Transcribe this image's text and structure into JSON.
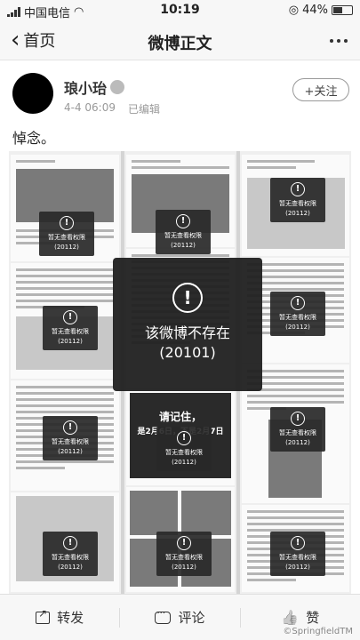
{
  "status_bar": {
    "carrier": "中国电信",
    "time": "10:19",
    "battery": "44%"
  },
  "nav": {
    "back_label": "首页",
    "title": "微博正文"
  },
  "post": {
    "author": "琅小珆",
    "date": "4-4 06:09",
    "edited": "已编辑",
    "follow_label": "+关注",
    "text": "悼念。"
  },
  "collage": {
    "badge_text": "暂无查看权限",
    "badge_code": "(20112)",
    "center_message_line1": "该微博不存在",
    "center_message_line2": "(20101)",
    "poster_line1": "请记住，",
    "poster_line2": "是2月6日，不是2月7日"
  },
  "actions": {
    "repost": "转发",
    "comment": "评论",
    "like": "赞"
  },
  "watermark": "©SpringfieldTM"
}
